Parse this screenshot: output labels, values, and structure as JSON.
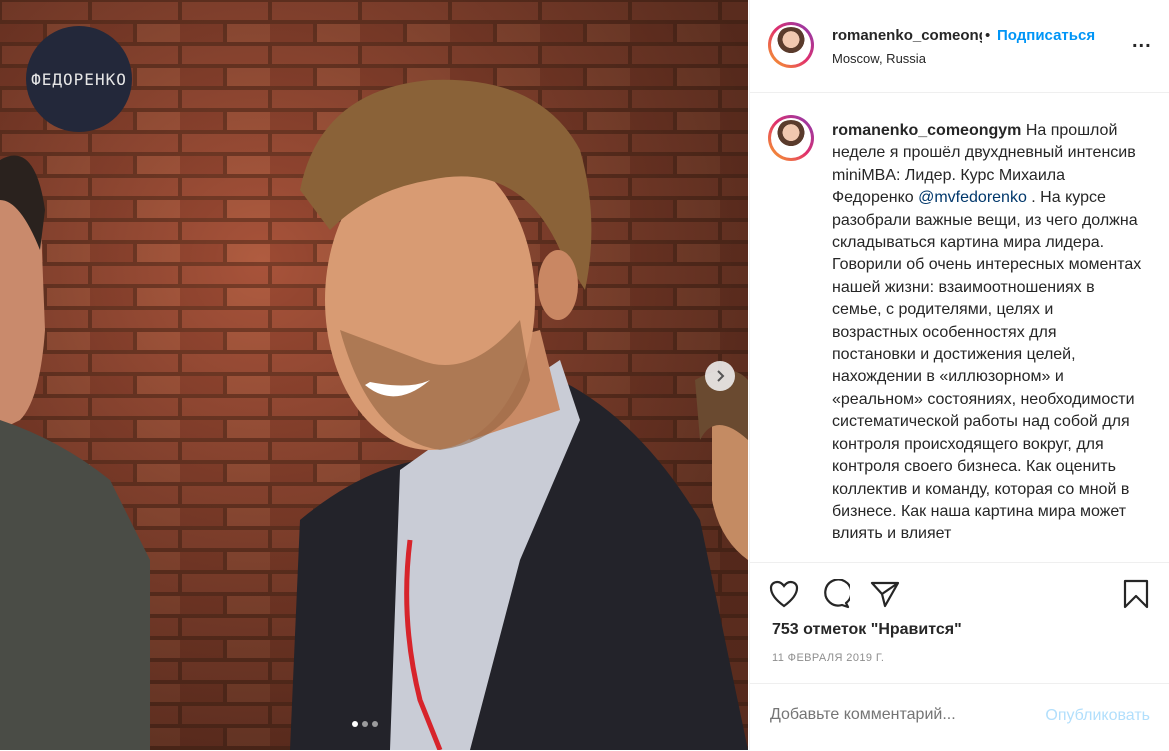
{
  "post": {
    "image_alt": "",
    "logo_text": "ФЕДОРЕНКО",
    "carousel": {
      "slide_count": 3,
      "active_index": 0
    }
  },
  "header": {
    "username": "romanenko_comeongym",
    "separator": "•",
    "follow_label": "Подписаться",
    "location": "Moscow, Russia",
    "more_label": "..."
  },
  "caption": {
    "username": "romanenko_comeongym",
    "text_before_mention": " На прошлой неделе я прошёл двухдневный интенсив miniMBA: Лидер. Курс Михаила Федоренко ",
    "mention": "@mvfedorenko",
    "text_after_mention": " . На курсе разобрали важные вещи, из чего должна складываться картина мира лидера. Говорили об очень интересных моментах нашей жизни: взаимоотношениях в семье, с родителями, целях и возрастных особенностях для постановки и достижения целей, нахождении в «иллюзорном» и «реальном» состояниях, необходимости систематической работы над собой для контроля происходящего вокруг, для контроля своего бизнеса. Как оценить коллектив и команду, которая со мной в бизнесе. Как наша картина мира может влиять и влияет"
  },
  "actions": {
    "likes": "753 отметок \"Нравится\"",
    "date": "11 ФЕВРАЛЯ 2019 Г."
  },
  "comment": {
    "placeholder": "Добавьте комментарий...",
    "publish_label": "Опубликовать"
  },
  "colors": {
    "accent": "#0095f6",
    "publish_disabled": "#b2dffc",
    "muted": "#8e8e8e"
  }
}
